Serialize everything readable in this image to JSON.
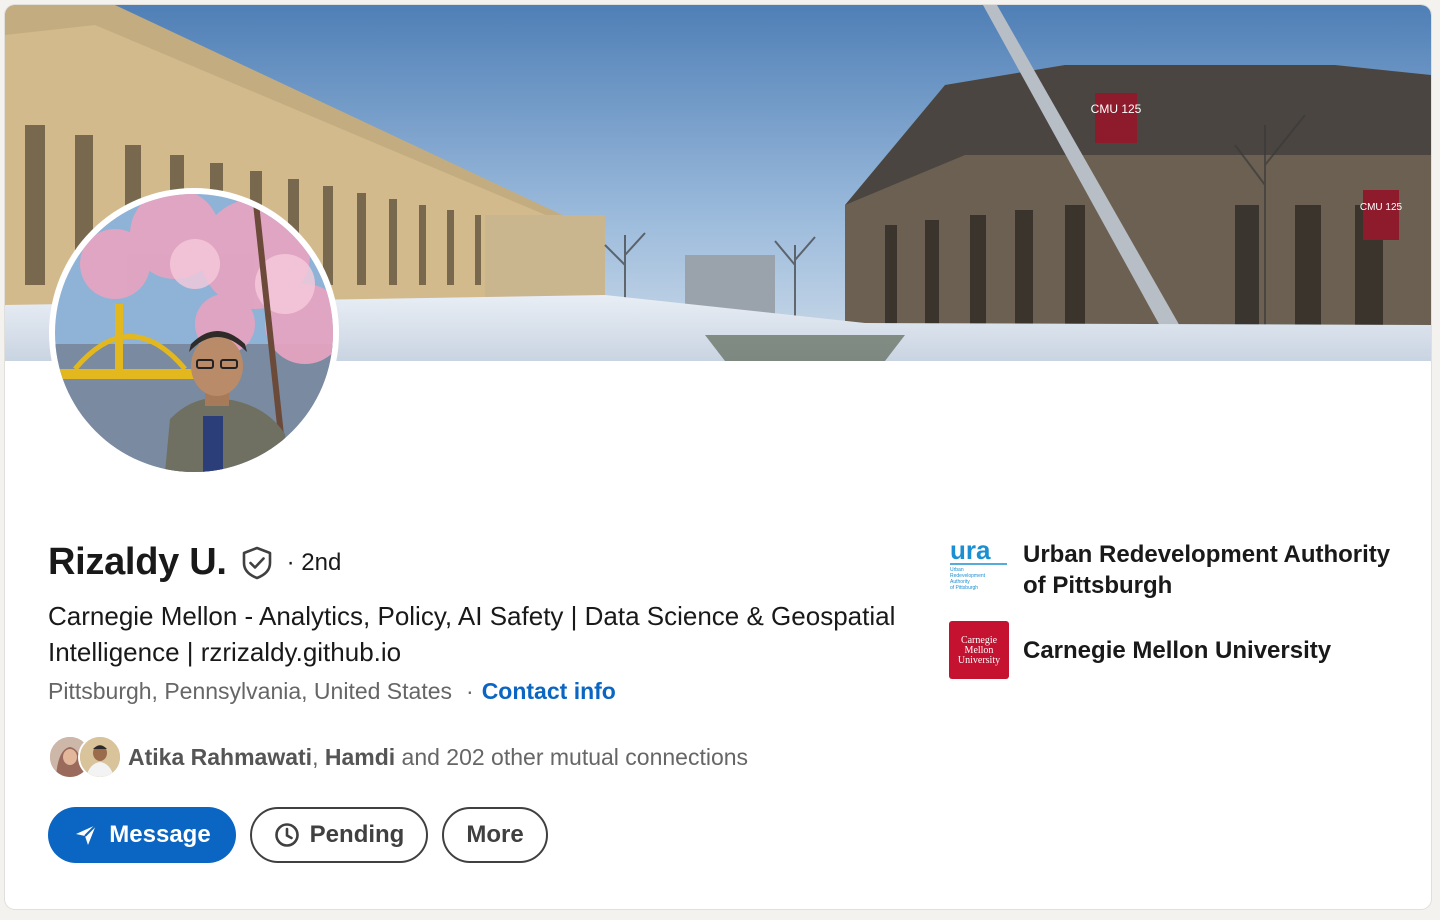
{
  "profile": {
    "name": "Rizaldy U.",
    "degree": "· 2nd",
    "headline": "Carnegie Mellon - Analytics, Policy, AI Safety | Data Science & Geospatial Intelligence | rzrizaldy.github.io",
    "location": "Pittsburgh, Pennsylvania, United States",
    "location_separator": "·",
    "contact_label": "Contact info"
  },
  "mutual": {
    "name1": "Atika Rahmawati",
    "separator": ", ",
    "name2": "Hamdi",
    "rest": " and 202 other mutual connections"
  },
  "actions": {
    "message_label": "Message",
    "pending_label": "Pending",
    "more_label": "More"
  },
  "orgs": [
    {
      "name": "Urban Redevelopment Authority of Pittsburgh",
      "logo_text": "ura",
      "logo_subtext": "Urban Redevelopment Authority of Pittsburgh",
      "icon": "ura-logo"
    },
    {
      "name": "Carnegie Mellon University",
      "logo_text": "Carnegie Mellon University",
      "icon": "cmu-logo"
    }
  ],
  "banner": {
    "sign_text_1": "CMU 125",
    "sign_text_2": "CMU 125"
  },
  "colors": {
    "link": "#0a66c2",
    "primary_button": "#0a66c2",
    "cmu_red": "#c41230",
    "ura_blue": "#1b8fd1"
  }
}
